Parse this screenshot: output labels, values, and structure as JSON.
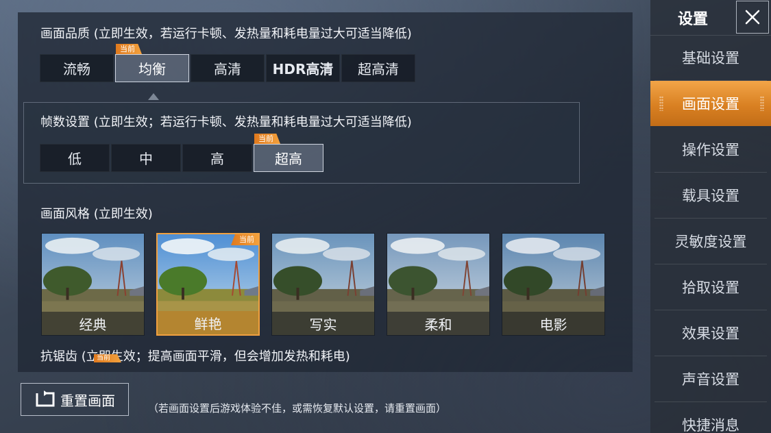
{
  "quality": {
    "title": "画面品质 (立即生效，若运行卡顿、发热量和耗电量过大可适当降低)",
    "options": [
      "流畅",
      "均衡",
      "高清",
      "HDR高清",
      "超高清"
    ],
    "selected": 1,
    "current_tag": "当前"
  },
  "fps": {
    "title": "帧数设置 (立即生效；若运行卡顿、发热量和耗电量过大可适当降低)",
    "options": [
      "低",
      "中",
      "高",
      "超高"
    ],
    "selected": 3,
    "current_tag": "当前"
  },
  "style": {
    "title": "画面风格 (立即生效)",
    "options": [
      "经典",
      "鲜艳",
      "写实",
      "柔和",
      "电影"
    ],
    "selected": 1,
    "current_tag": "当前"
  },
  "antialias": {
    "title": "抗锯齿 (立即生效；提高画面平滑，但会增加发热和耗电)",
    "current_tag": "当前"
  },
  "reset": {
    "label": "重置画面",
    "note": "（若画面设置后游戏体验不佳，或需恢复默认设置，请重置画面）"
  },
  "sidebar": {
    "title": "设置",
    "items": [
      "基础设置",
      "画面设置",
      "操作设置",
      "载具设置",
      "灵敏度设置",
      "拾取设置",
      "效果设置",
      "声音设置",
      "快捷消息"
    ],
    "selected": 1
  },
  "colors": {
    "accent": "#e08a2a",
    "panel": "#202834"
  },
  "icons": {
    "close": "close-icon",
    "reset": "reset-icon"
  }
}
